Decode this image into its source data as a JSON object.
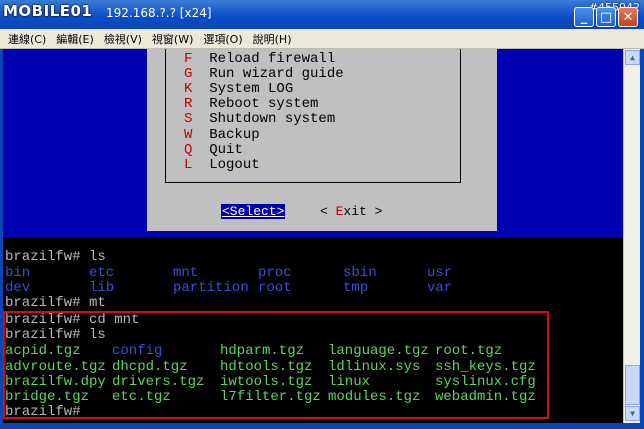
{
  "window": {
    "logo": "MOBILE01",
    "title": "192.168.?.? [x24]",
    "watermark": "#455942"
  },
  "menubar": [
    "連線(C)",
    "編輯(E)",
    "檢視(V)",
    "視窗(W)",
    "選項(O)",
    "說明(H)"
  ],
  "dialog": {
    "items": [
      {
        "key": "F",
        "label": "Reload firewall"
      },
      {
        "key": "G",
        "label": "Run wizard guide"
      },
      {
        "key": "K",
        "label": "System LOG"
      },
      {
        "key": "R",
        "label": "Reboot system"
      },
      {
        "key": "S",
        "label": "Shutdown system"
      },
      {
        "key": "W",
        "label": "Backup"
      },
      {
        "key": "Q",
        "label": "Quit"
      },
      {
        "key": "L",
        "label": "Logout"
      }
    ],
    "select_label": "<Select>",
    "exit_prefix": "< ",
    "exit_key": "E",
    "exit_rest": "xit >"
  },
  "terminal": {
    "prompt1": "brazilfw# ls",
    "ls_rows": [
      [
        "bin",
        "etc",
        "mnt",
        "proc",
        "sbin",
        "usr"
      ],
      [
        "dev",
        "lib",
        "partition",
        "root",
        "tmp",
        "var"
      ]
    ],
    "prompt2": "brazilfw# mt",
    "prompt3": "brazilfw# cd mnt",
    "prompt4": "brazilfw# ls",
    "mnt_rows": [
      [
        "acpid.tgz",
        "config",
        "hdparm.tgz",
        "language.tgz",
        "root.tgz"
      ],
      [
        "advroute.tgz",
        "dhcpd.tgz",
        "hdtools.tgz",
        "ldlinux.sys",
        "ssh_keys.tgz"
      ],
      [
        "brazilfw.dpy",
        "drivers.tgz",
        "iwtools.tgz",
        "linux",
        "syslinux.cfg"
      ],
      [
        "bridge.tgz",
        "etc.tgz",
        "l7filter.tgz",
        "modules.tgz",
        "webadmin.tgz"
      ]
    ],
    "prompt5": "brazilfw#"
  },
  "colors": {
    "dir": "#3b4fd6",
    "file": "#5fd35f",
    "highlight_box": "#d01010",
    "dialog_bg": "#c0c0c0",
    "screen_blue": "#0000b3"
  }
}
